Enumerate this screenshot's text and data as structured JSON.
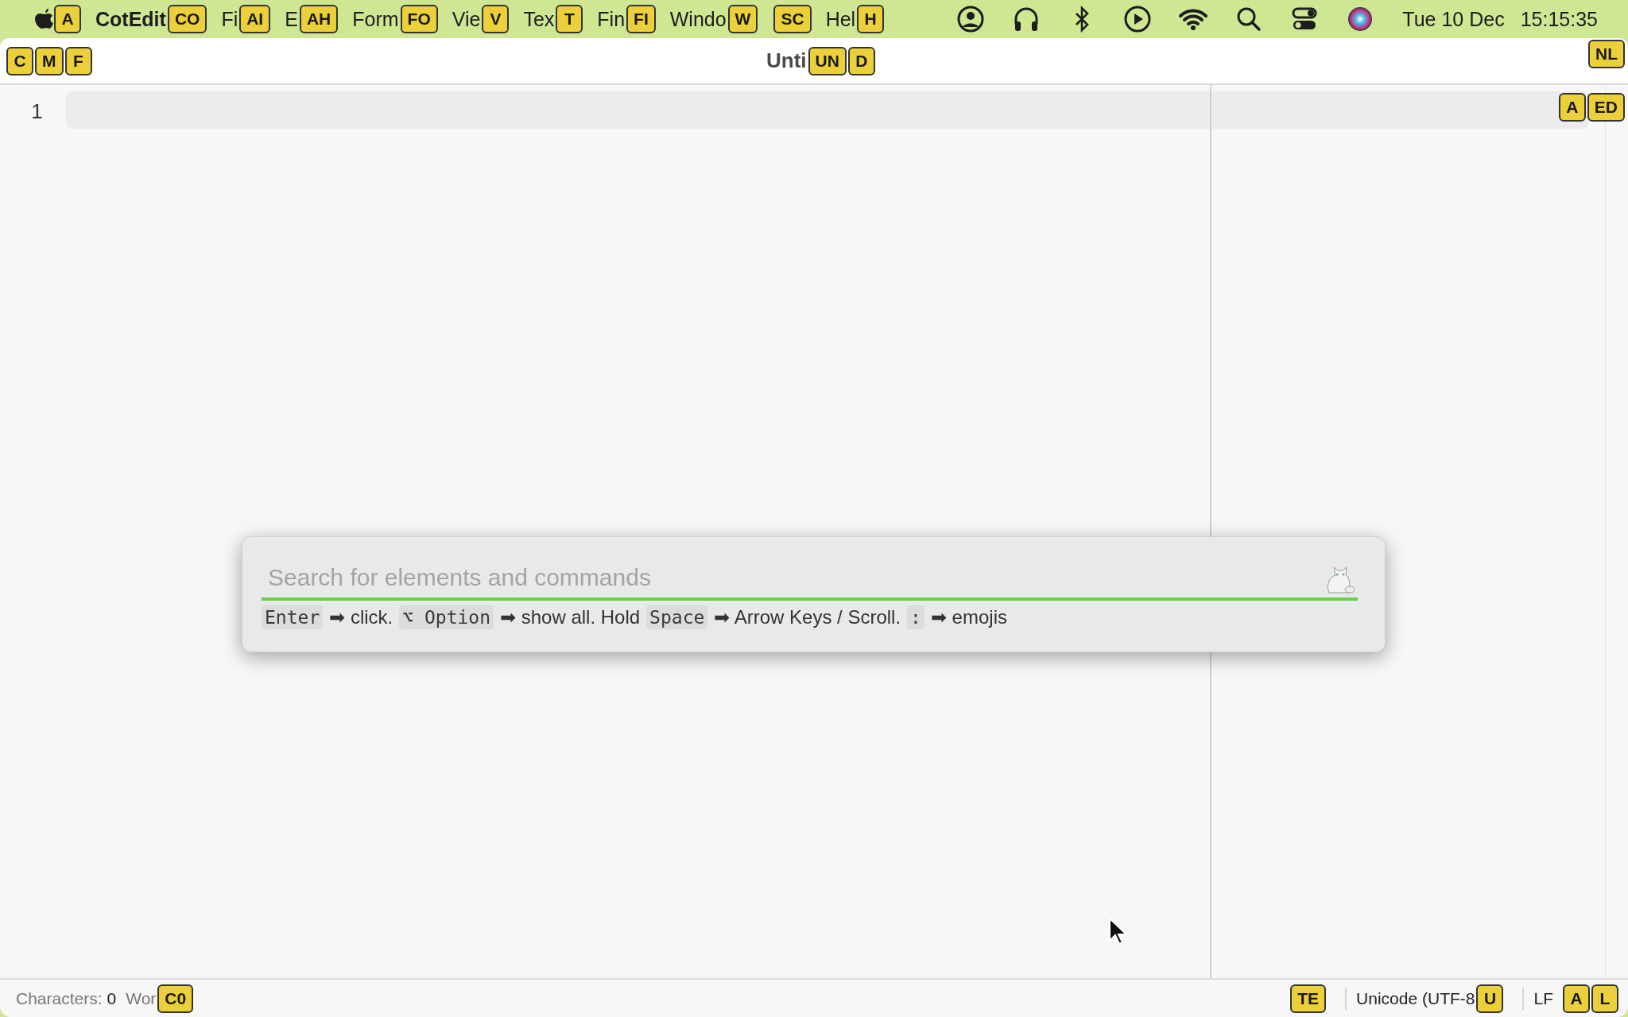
{
  "menu_bar": {
    "items": [
      {
        "kind": "apple",
        "hint": "A"
      },
      {
        "kind": "app",
        "label": "CotEdit",
        "hint": "CO"
      },
      {
        "kind": "menu",
        "label": "Fi",
        "hint": "AI"
      },
      {
        "kind": "menu",
        "label": "E",
        "hint": "AH"
      },
      {
        "kind": "menu",
        "label": "Form",
        "hint": "FO"
      },
      {
        "kind": "menu",
        "label": "Vie",
        "hint": "V"
      },
      {
        "kind": "menu",
        "label": "Tex",
        "hint": "T"
      },
      {
        "kind": "menu",
        "label": "Fin",
        "hint": "FI"
      },
      {
        "kind": "menu",
        "label": "Windo",
        "hint": "W"
      },
      {
        "kind": "menu",
        "hint": "SC"
      },
      {
        "kind": "menu",
        "label": "Hel",
        "hint": "H"
      }
    ],
    "date": "Tue 10 Dec",
    "time": "15:15:35"
  },
  "window": {
    "button_hints": [
      "C",
      "M",
      "F"
    ],
    "title": "Unti",
    "title_hints": [
      "UN",
      "D"
    ],
    "toolbar_hint": "NL"
  },
  "editor": {
    "line_numbers": [
      "1"
    ],
    "hints": [
      "A",
      "ED"
    ]
  },
  "command_palette": {
    "placeholder": "Search for elements and commands",
    "help": [
      {
        "kind": "key",
        "text": "Enter"
      },
      {
        "kind": "text",
        "text": "➡ click."
      },
      {
        "kind": "key",
        "text": "⌥ Option"
      },
      {
        "kind": "text",
        "text": "➡ show all. Hold"
      },
      {
        "kind": "key",
        "text": "Space"
      },
      {
        "kind": "text",
        "text": "➡ Arrow Keys / Scroll."
      },
      {
        "kind": "key",
        "text": ":"
      },
      {
        "kind": "text",
        "text": "➡ emojis"
      }
    ]
  },
  "status_bar": {
    "left": [
      {
        "kind": "count",
        "label": "Characters:",
        "value": "0"
      },
      {
        "kind": "label",
        "label": "Wor",
        "hint": "C0"
      }
    ],
    "right": [
      {
        "kind": "hint",
        "hint": "TE"
      },
      {
        "kind": "label",
        "label": "Unicode (UTF-8",
        "hint": "U"
      },
      {
        "kind": "label",
        "label": "LF",
        "hints": [
          "A",
          "L"
        ]
      }
    ]
  }
}
